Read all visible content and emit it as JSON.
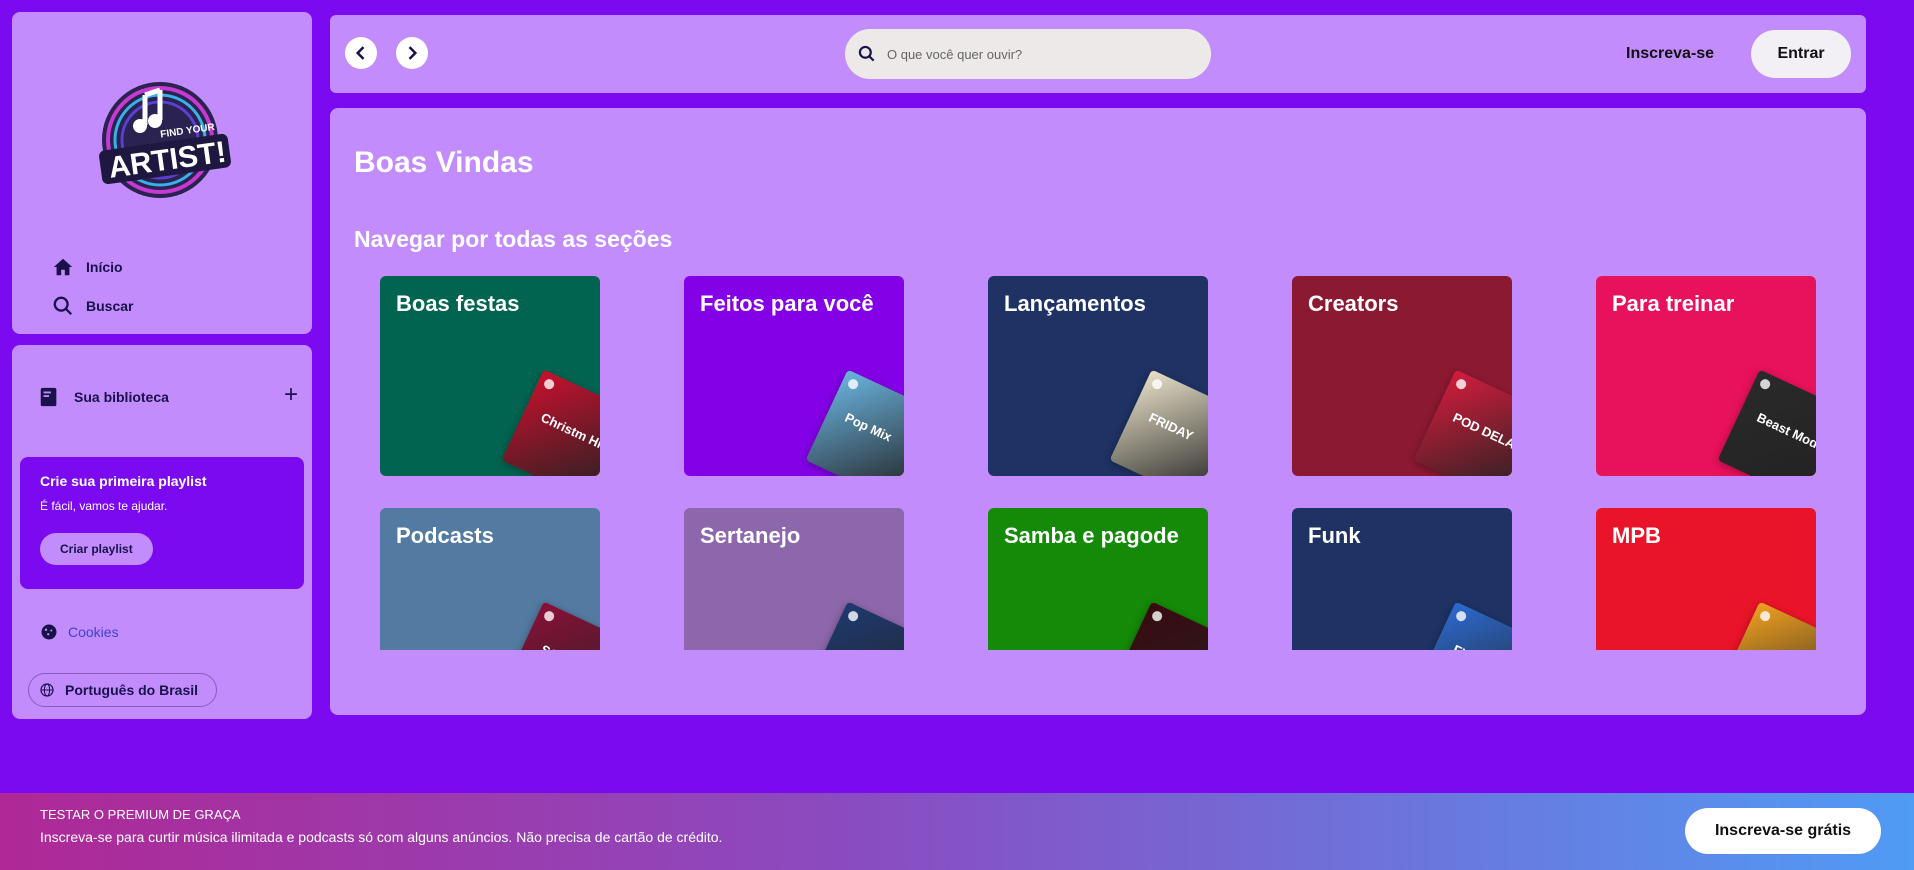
{
  "sidebar": {
    "logo_text": "FIND YOUR ARTIST!",
    "nav": [
      {
        "label": "Início",
        "icon": "home-icon"
      },
      {
        "label": "Buscar",
        "icon": "search-icon"
      }
    ],
    "library": {
      "label": "Sua biblioteca",
      "add_icon": "+"
    },
    "playlist_card": {
      "title": "Crie sua primeira playlist",
      "subtitle": "É fácil, vamos te ajudar.",
      "button": "Criar playlist"
    },
    "cookies": "Cookies",
    "language": "Português do Brasil"
  },
  "header": {
    "search_placeholder": "O que você quer ouvir?",
    "signup": "Inscreva-se",
    "login": "Entrar"
  },
  "main": {
    "title": "Boas Vindas",
    "section_title": "Navegar por todas as seções",
    "cards": [
      {
        "title": "Boas festas",
        "color": "#006450",
        "art_color": "#c8102e",
        "art_label": "Christm Hit"
      },
      {
        "title": "Feitos para você",
        "color": "#8400e7",
        "art_color": "#6ab4e0",
        "art_label": "Pop Mix"
      },
      {
        "title": "Lançamentos",
        "color": "#1e3264",
        "art_color": "#e8e0c8",
        "art_label": "FRIDAY"
      },
      {
        "title": "Creators",
        "color": "#8c1932",
        "art_color": "#d41c3c",
        "art_label": "POD DELAS"
      },
      {
        "title": "Para treinar",
        "color": "#e8115b",
        "art_color": "#2a2a2a",
        "art_label": "Beast Mode"
      },
      {
        "title": "Podcasts",
        "color": "#537aa1",
        "art_color": "#8a1038",
        "art_label": "SCIE"
      },
      {
        "title": "Sertanejo",
        "color": "#8d67ab",
        "art_color": "#1e3a70",
        "art_label": ""
      },
      {
        "title": "Samba e pagode",
        "color": "#148a08",
        "art_color": "#3a0a10",
        "art_label": ""
      },
      {
        "title": "Funk",
        "color": "#1e3264",
        "art_color": "#2c6ad0",
        "art_label": "FUN"
      },
      {
        "title": "MPB",
        "color": "#e91429",
        "art_color": "#f0a020",
        "art_label": ""
      }
    ]
  },
  "banner": {
    "title": "TESTAR O PREMIUM DE GRAÇA",
    "text": "Inscreva-se para curtir música ilimitada e podcasts só com alguns anúncios. Não precisa de cartão de crédito.",
    "button": "Inscreva-se grátis"
  }
}
